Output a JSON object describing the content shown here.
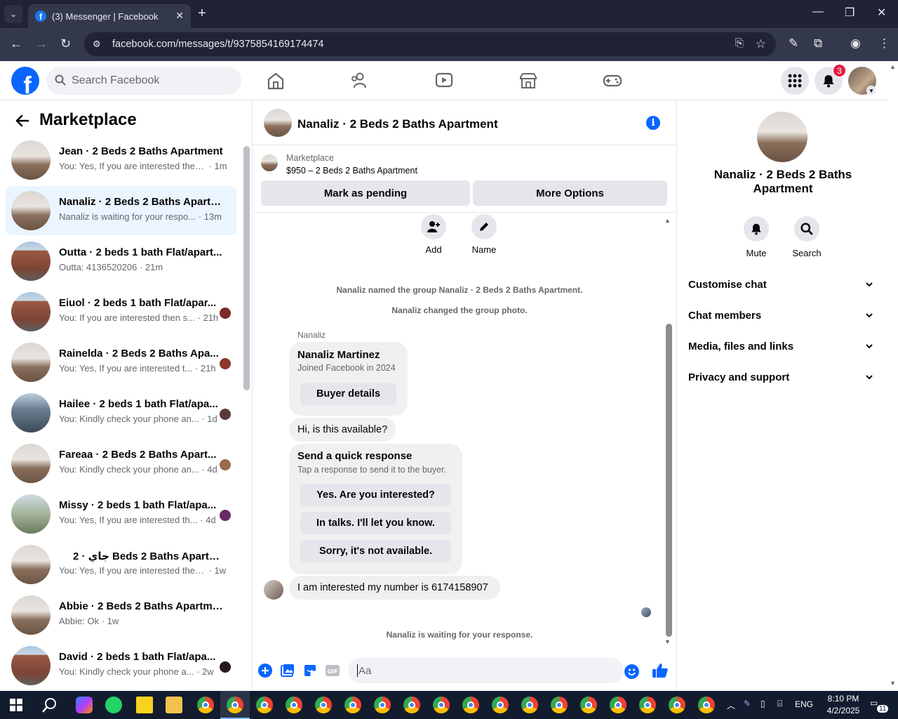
{
  "browser": {
    "tab_title": "(3) Messenger | Facebook",
    "url": "facebook.com/messages/t/9375854169174474"
  },
  "fb": {
    "search_placeholder": "Search Facebook",
    "notification_count": "3"
  },
  "left": {
    "title": "Marketplace",
    "conversations": [
      {
        "name": "Jean · 2 Beds 2 Baths Apartment",
        "preview": "You: Yes, If you are interested then...",
        "time": " · 1m",
        "avatar": "interior"
      },
      {
        "name": "Nanaliz · 2 Beds 2 Baths Apartm...",
        "preview": "Nanaliz is waiting for your respo...",
        "time": " · 13m",
        "avatar": "interior"
      },
      {
        "name": "Outta · 2 beds 1 bath Flat/apart...",
        "preview": "Outta: 4136520206",
        "time": " · 21m",
        "avatar": "brick"
      },
      {
        "name": "Eiuol · 2 beds 1 bath Flat/apar...",
        "preview": "You: If you are interested then s...",
        "time": " · 21h",
        "avatar": "brick"
      },
      {
        "name": "Rainelda · 2 Beds 2 Baths Apa...",
        "preview": "You: Yes, If you are interested t...",
        "time": " · 21h",
        "avatar": "interior"
      },
      {
        "name": "Hailee · 2 beds 1 bath Flat/apa...",
        "preview": "You: Kindly check your phone an...",
        "time": " · 1d",
        "avatar": "blue"
      },
      {
        "name": "Fareaa · 2 Beds 2 Baths Apart...",
        "preview": "You: Kindly check your phone an...",
        "time": " · 4d",
        "avatar": "interior"
      },
      {
        "name": "Missy · 2 beds 1 bath Flat/apa...",
        "preview": "You: Yes, If you are interested th...",
        "time": " · 4d",
        "avatar": "house"
      },
      {
        "name": "جاي · 2 Beds 2 Baths Apartment",
        "preview": "You: Yes, If you are interested then ...",
        "time": " · 1w",
        "avatar": "interior"
      },
      {
        "name": "Abbie · 2 Beds 2 Baths Apartment",
        "preview": "Abbie: Ok",
        "time": " · 1w",
        "avatar": "interior"
      },
      {
        "name": "David · 2 beds 1 bath Flat/apa...",
        "preview": "You: Kindly check your phone a...",
        "time": " · 2w",
        "avatar": "brick"
      }
    ]
  },
  "chat": {
    "title": "Nanaliz · 2 Beds 2 Baths Apartment",
    "listing_source": "Marketplace",
    "listing_price": "$950 – 2 Beds 2 Baths Apartment",
    "mark_pending": "Mark as pending",
    "more_options": "More Options",
    "add_label": "Add",
    "name_label": "Name",
    "sys_named": "Nanaliz named the group Nanaliz · 2 Beds 2 Baths Apartment.",
    "sys_photo": "Nanaliz changed the group photo.",
    "sender": "Nanaliz",
    "profile_name": "Nanaliz Martinez",
    "profile_joined": "Joined Facebook in 2024",
    "buyer_details": "Buyer details",
    "msg_available": "Hi, is this available?",
    "quick_title": "Send a quick response",
    "quick_sub": "Tap a response to send it to the buyer.",
    "quick_1": "Yes. Are you interested?",
    "quick_2": "In talks. I'll let you know.",
    "quick_3": "Sorry, it's not available.",
    "msg_number": "I am interested my number is 6174158907",
    "waiting": "Nanaliz is waiting for your response.",
    "composer_placeholder": "Aa"
  },
  "right": {
    "name": "Nanaliz · 2 Beds 2 Baths Apartment",
    "mute": "Mute",
    "search": "Search",
    "sections": [
      "Customise chat",
      "Chat members",
      "Media, files and links",
      "Privacy and support"
    ]
  },
  "taskbar": {
    "lang": "ENG",
    "time": "8:10 PM",
    "date": "4/2/2025",
    "notif": "11"
  }
}
